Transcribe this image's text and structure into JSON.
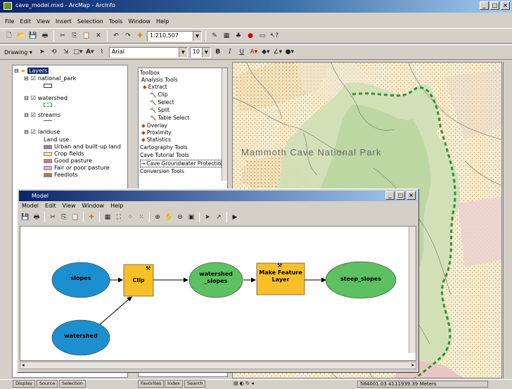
{
  "window": {
    "title": "cave_model.mxd - ArcMap - ArcInfo"
  },
  "menus": [
    "File",
    "Edit",
    "View",
    "Insert",
    "Selection",
    "Tools",
    "Window",
    "Help"
  ],
  "toolbar": {
    "scale": "1:210,507"
  },
  "drawing_toolbar": {
    "drawing_label": "Drawing ▾",
    "font": "Arial",
    "font_size": "10"
  },
  "toc": {
    "root": "Layers",
    "layers": [
      {
        "name": "national_park"
      },
      {
        "name": "watershed"
      },
      {
        "name": "streams"
      },
      {
        "name": "landuse",
        "heading": "Land use",
        "legend": [
          {
            "label": "Urban and built-up land",
            "color": "#8c8c8c"
          },
          {
            "label": "Crop fields",
            "color": "#f2e68a"
          },
          {
            "label": "Good pasture",
            "color": "#c97a8a"
          },
          {
            "label": "Fair or poor pasture",
            "color": "#e6b0b8"
          },
          {
            "label": "Feedlots",
            "color": "#b07840"
          }
        ]
      }
    ]
  },
  "toolbox": {
    "title": "Toolbox",
    "items": [
      {
        "label": "Analysis Tools",
        "level": 0
      },
      {
        "label": "Extract",
        "level": 1
      },
      {
        "label": "Clip",
        "level": 2
      },
      {
        "label": "Select",
        "level": 2
      },
      {
        "label": "Split",
        "level": 2
      },
      {
        "label": "Table Select",
        "level": 2
      },
      {
        "label": "Overlay",
        "level": 1
      },
      {
        "label": "Proximity",
        "level": 1
      },
      {
        "label": "Statistics",
        "level": 1
      },
      {
        "label": "Cartography Tools",
        "level": 0
      },
      {
        "label": "Cave Tutorial Tools",
        "level": 0
      },
      {
        "label": "Cave Groundwater Protectio",
        "level": 1
      },
      {
        "label": "Conversion Tools",
        "level": 0
      }
    ]
  },
  "map": {
    "label": "Mammoth Cave National Park",
    "status": "584001.03  4111939.39 Meters"
  },
  "model": {
    "title": "Model",
    "menus": [
      "Model",
      "Edit",
      "View",
      "Window",
      "Help"
    ],
    "nodes": [
      {
        "id": "slopes",
        "label": "slopes",
        "kind": "input"
      },
      {
        "id": "watershed",
        "label": "watershed",
        "kind": "input"
      },
      {
        "id": "clip",
        "label": "Clip",
        "kind": "tool"
      },
      {
        "id": "watershed_slopes",
        "label": "watershed _slopes",
        "kind": "output"
      },
      {
        "id": "make_feature_layer",
        "label": "Make Feature Layer",
        "kind": "tool"
      },
      {
        "id": "steep_slopes",
        "label": "steep_slopes",
        "kind": "output"
      }
    ],
    "colors": {
      "input": "#1b8fd0",
      "tool": "#f7bf2a",
      "output": "#5dc061"
    }
  },
  "tabs": {
    "display": "Display",
    "source": "Source",
    "selection": "Selection",
    "favorites": "Favorites",
    "index": "Index",
    "search": "Search"
  }
}
